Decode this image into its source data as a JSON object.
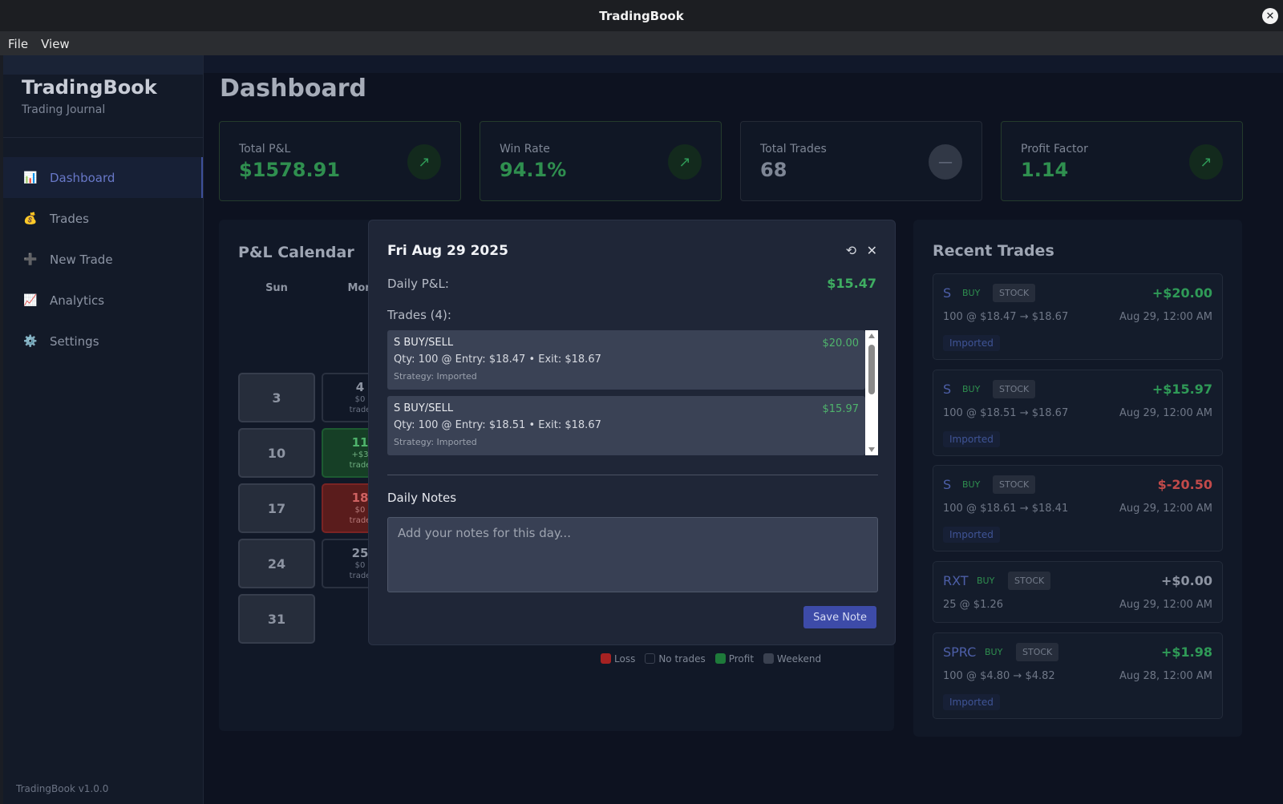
{
  "window": {
    "title": "TradingBook",
    "close_glyph": "✕"
  },
  "menu": [
    "File",
    "View"
  ],
  "sidebar": {
    "brand": "TradingBook",
    "subtitle": "Trading Journal",
    "items": [
      {
        "label": "Dashboard",
        "icon": "bar-chart-icon",
        "glyph": "📊"
      },
      {
        "label": "Trades",
        "icon": "money-bag-icon",
        "glyph": "💰"
      },
      {
        "label": "New Trade",
        "icon": "plus-icon",
        "glyph": "➕"
      },
      {
        "label": "Analytics",
        "icon": "trend-chart-icon",
        "glyph": "📈"
      },
      {
        "label": "Settings",
        "icon": "gear-icon",
        "glyph": "⚙️"
      }
    ],
    "version": "TradingBook v1.0.0"
  },
  "main": {
    "title": "Dashboard"
  },
  "stats": [
    {
      "label": "Total P&L",
      "value": "$1578.91",
      "glyph": "↗"
    },
    {
      "label": "Win Rate",
      "value": "94.1%",
      "glyph": "↗"
    },
    {
      "label": "Total Trades",
      "value": "68",
      "glyph": "—"
    },
    {
      "label": "Profit Factor",
      "value": "1.14",
      "glyph": "↗"
    }
  ],
  "calendar": {
    "title": "P&L Calendar",
    "days_of_week": [
      "Sun",
      "Mon"
    ],
    "cells": [
      {
        "day": "3"
      },
      {
        "day": "4",
        "pnl": "$0",
        "trades": "trade"
      },
      {
        "day": "10"
      },
      {
        "day": "11",
        "pnl": "+$3",
        "trades": "trade"
      },
      {
        "day": "17"
      },
      {
        "day": "18",
        "pnl": "$0",
        "trades": "trade"
      },
      {
        "day": "24"
      },
      {
        "day": "25",
        "pnl": "$0",
        "trades": "trade"
      },
      {
        "day": "31"
      }
    ],
    "legend": [
      "Loss",
      "No trades",
      "Profit",
      "Weekend"
    ],
    "colors": {
      "loss": "#a62222",
      "profit": "#1e7a3a",
      "weekend": "#3a4150"
    }
  },
  "recent": {
    "title": "Recent Trades",
    "trades": [
      {
        "symbol": "S",
        "side": "BUY",
        "type": "STOCK",
        "pnl": "+$20.00",
        "detail": "100 @ $18.47 → $18.67",
        "date": "Aug 29, 12:00 AM",
        "tag": "Imported"
      },
      {
        "symbol": "S",
        "side": "BUY",
        "type": "STOCK",
        "pnl": "+$15.97",
        "detail": "100 @ $18.51 → $18.67",
        "date": "Aug 29, 12:00 AM",
        "tag": "Imported"
      },
      {
        "symbol": "S",
        "side": "BUY",
        "type": "STOCK",
        "pnl": "$-20.50",
        "detail": "100 @ $18.61 → $18.41",
        "date": "Aug 29, 12:00 AM",
        "tag": "Imported"
      },
      {
        "symbol": "RXT",
        "side": "BUY",
        "type": "STOCK",
        "pnl": "+$0.00",
        "detail": "25 @ $1.26",
        "date": "Aug 29, 12:00 AM"
      },
      {
        "symbol": "SPRC",
        "side": "BUY",
        "type": "STOCK",
        "pnl": "+$1.98",
        "detail": "100 @ $4.80 → $4.82",
        "date": "Aug 28, 12:00 AM",
        "tag": "Imported"
      }
    ],
    "colors": {
      "positive": "#2f9a57",
      "negative": "#c24a4a",
      "zero": "#8d94a2"
    }
  },
  "modal": {
    "title": "Fri Aug 29 2025",
    "refresh_glyph": "⟲",
    "close_glyph": "✕",
    "daily_pnl_label": "Daily P&L:",
    "daily_pnl": "$15.47",
    "trades_label": "Trades (4):",
    "trades": [
      {
        "title": "S BUY/SELL",
        "pnl": "$20.00",
        "detail": "Qty: 100 @ Entry: $18.47 • Exit: $18.67",
        "strategy": "Strategy: Imported"
      },
      {
        "title": "S BUY/SELL",
        "pnl": "$15.97",
        "detail": "Qty: 100 @ Entry: $18.51 • Exit: $18.67",
        "strategy": "Strategy: Imported"
      }
    ],
    "notes_label": "Daily Notes",
    "notes_placeholder": "Add your notes for this day...",
    "save_label": "Save Note"
  }
}
